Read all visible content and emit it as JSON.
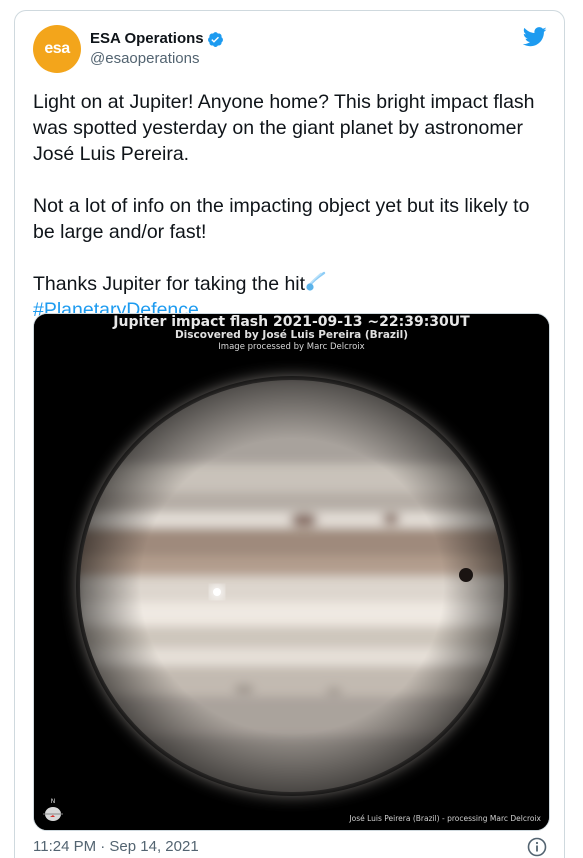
{
  "account": {
    "display_name": "ESA Operations",
    "handle": "@esaoperations",
    "avatar_text": "esa",
    "verified": true
  },
  "tweet": {
    "line1": "Light on at Jupiter! Anyone home? This bright impact flash was spotted yesterday on the giant planet by astronomer José Luis Pereira.",
    "line2": "Not a lot of info on the impacting object yet but its likely to be large and/or fast!",
    "line3": "Thanks Jupiter for taking the hit",
    "hashtag": "#PlanetaryDefence",
    "emoji": "comet-icon"
  },
  "media": {
    "title": "Jupiter impact flash 2021-09-13 ~22:39:30UT",
    "subtitle": "Discovered by José Luis Pereira (Brazil)",
    "processed": "Image processed by Marc Delcroix",
    "credit": "José Luis Peirera (Brazil) - processing Marc Delcroix"
  },
  "footer": {
    "timestamp": "11:24 PM · Sep 14, 2021"
  },
  "colors": {
    "accent": "#1d9bf0",
    "avatar_bg": "#f3a51b",
    "muted": "#536471"
  }
}
